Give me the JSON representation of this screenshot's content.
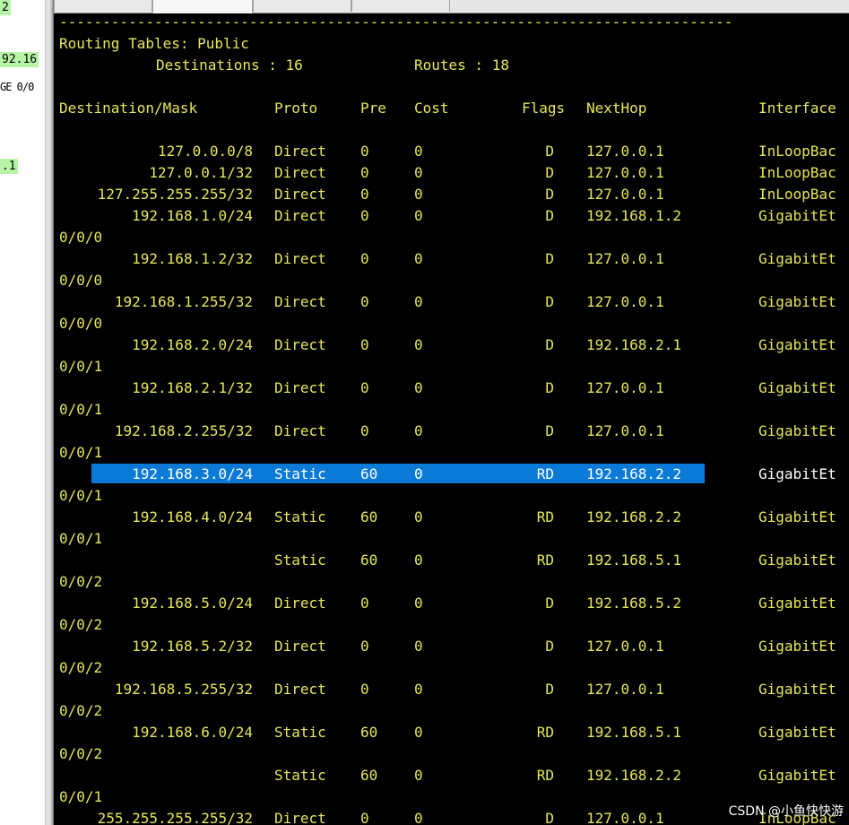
{
  "topology_labels": [
    "2",
    "92.16",
    "GE 0/0",
    ".1"
  ],
  "tabs": [
    "",
    "",
    "",
    ""
  ],
  "terminal": {
    "separator": "------------------------------------------------------------------------------",
    "title": "Routing Tables: Public",
    "destinations_label": "Destinations : 16",
    "routes_label": "Routes : 18",
    "columns": {
      "dest": "Destination/Mask",
      "proto": "Proto",
      "pre": "Pre",
      "cost": "Cost",
      "flags": "Flags",
      "nexthop": "NextHop",
      "iface": "Interface"
    },
    "routes": [
      {
        "dest": "127.0.0.0/8",
        "proto": "Direct",
        "pre": "0",
        "cost": "0",
        "flags": "D",
        "nexthop": "127.0.0.1",
        "iface": "InLoopBac",
        "cont": ""
      },
      {
        "dest": "127.0.0.1/32",
        "proto": "Direct",
        "pre": "0",
        "cost": "0",
        "flags": "D",
        "nexthop": "127.0.0.1",
        "iface": "InLoopBac",
        "cont": ""
      },
      {
        "dest": "127.255.255.255/32",
        "proto": "Direct",
        "pre": "0",
        "cost": "0",
        "flags": "D",
        "nexthop": "127.0.0.1",
        "iface": "InLoopBac",
        "cont": ""
      },
      {
        "dest": "192.168.1.0/24",
        "proto": "Direct",
        "pre": "0",
        "cost": "0",
        "flags": "D",
        "nexthop": "192.168.1.2",
        "iface": "GigabitEt",
        "cont": "0/0/0"
      },
      {
        "dest": "192.168.1.2/32",
        "proto": "Direct",
        "pre": "0",
        "cost": "0",
        "flags": "D",
        "nexthop": "127.0.0.1",
        "iface": "GigabitEt",
        "cont": "0/0/0"
      },
      {
        "dest": "192.168.1.255/32",
        "proto": "Direct",
        "pre": "0",
        "cost": "0",
        "flags": "D",
        "nexthop": "127.0.0.1",
        "iface": "GigabitEt",
        "cont": "0/0/0"
      },
      {
        "dest": "192.168.2.0/24",
        "proto": "Direct",
        "pre": "0",
        "cost": "0",
        "flags": "D",
        "nexthop": "192.168.2.1",
        "iface": "GigabitEt",
        "cont": "0/0/1"
      },
      {
        "dest": "192.168.2.1/32",
        "proto": "Direct",
        "pre": "0",
        "cost": "0",
        "flags": "D",
        "nexthop": "127.0.0.1",
        "iface": "GigabitEt",
        "cont": "0/0/1"
      },
      {
        "dest": "192.168.2.255/32",
        "proto": "Direct",
        "pre": "0",
        "cost": "0",
        "flags": "D",
        "nexthop": "127.0.0.1",
        "iface": "GigabitEt",
        "cont": "0/0/1"
      },
      {
        "dest": "192.168.3.0/24",
        "proto": "Static",
        "pre": "60",
        "cost": "0",
        "flags": "RD",
        "nexthop": "192.168.2.2",
        "iface": "GigabitEt",
        "cont": "0/0/1",
        "selected": true
      },
      {
        "dest": "192.168.4.0/24",
        "proto": "Static",
        "pre": "60",
        "cost": "0",
        "flags": "RD",
        "nexthop": "192.168.2.2",
        "iface": "GigabitEt",
        "cont": "0/0/1"
      },
      {
        "dest": "",
        "proto": "Static",
        "pre": "60",
        "cost": "0",
        "flags": "RD",
        "nexthop": "192.168.5.1",
        "iface": "GigabitEt",
        "cont": "0/0/2"
      },
      {
        "dest": "192.168.5.0/24",
        "proto": "Direct",
        "pre": "0",
        "cost": "0",
        "flags": "D",
        "nexthop": "192.168.5.2",
        "iface": "GigabitEt",
        "cont": "0/0/2"
      },
      {
        "dest": "192.168.5.2/32",
        "proto": "Direct",
        "pre": "0",
        "cost": "0",
        "flags": "D",
        "nexthop": "127.0.0.1",
        "iface": "GigabitEt",
        "cont": "0/0/2"
      },
      {
        "dest": "192.168.5.255/32",
        "proto": "Direct",
        "pre": "0",
        "cost": "0",
        "flags": "D",
        "nexthop": "127.0.0.1",
        "iface": "GigabitEt",
        "cont": "0/0/2"
      },
      {
        "dest": "192.168.6.0/24",
        "proto": "Static",
        "pre": "60",
        "cost": "0",
        "flags": "RD",
        "nexthop": "192.168.5.1",
        "iface": "GigabitEt",
        "cont": "0/0/2"
      },
      {
        "dest": "",
        "proto": "Static",
        "pre": "60",
        "cost": "0",
        "flags": "RD",
        "nexthop": "192.168.2.2",
        "iface": "GigabitEt",
        "cont": "0/0/1"
      },
      {
        "dest": "255.255.255.255/32",
        "proto": "Direct",
        "pre": "0",
        "cost": "0",
        "flags": "D",
        "nexthop": "127.0.0.1",
        "iface": "InLoopBac",
        "cont": ""
      }
    ]
  },
  "watermark": "CSDN @小鱼快快游"
}
